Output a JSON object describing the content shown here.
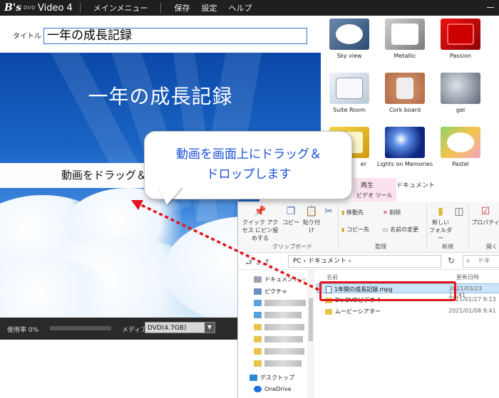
{
  "app": {
    "logo_b": "B's",
    "logo_dvd": "DVD",
    "logo_name": "Video 4",
    "menu": [
      "メインメニュー",
      "保存",
      "設定",
      "ヘルプ"
    ],
    "window_minimize": "ー"
  },
  "title_field": {
    "label": "タイトル",
    "value": "一年の成長記録"
  },
  "preview": {
    "menu_title": "一年の成長記録",
    "drag_hint": "動画をドラッグ＆"
  },
  "status": {
    "usage": "使用率 0%",
    "usage_fraction": 0,
    "media_label": "メディア",
    "media_value": "DVD(4.7GB)"
  },
  "templates": [
    {
      "label": "Sky view",
      "color": "#3a5f8f",
      "icon": "oval-frame"
    },
    {
      "label": "Metallic",
      "color": "#9a9a9a",
      "icon": "rounded-frame"
    },
    {
      "label": "Passion",
      "color": "#c30f0f",
      "icon": "rounded-frame"
    },
    {
      "label": "Suite Room",
      "color": "#dfe8f2",
      "icon": "stacked-frames"
    },
    {
      "label": "Cork board",
      "color": "#c98560",
      "icon": "photo-on-cork"
    },
    {
      "label": "gel",
      "color": "#6c7787",
      "icon": "water-drop"
    },
    {
      "label": "er",
      "color": "#e8c220",
      "icon": "yellow-frame"
    },
    {
      "label": "Lights on Memories",
      "color": "#0d2a8a",
      "icon": "light-glow"
    },
    {
      "label": "Pastel",
      "color": "#f3c14a",
      "icon": "oval-frame"
    }
  ],
  "callout": {
    "line1": "動画を画面上にドラッグ＆",
    "line2": "ドロップします"
  },
  "explorer": {
    "ribbon_tabs": {
      "play": "再生",
      "video_tools": "ビデオ ツール",
      "document": "ドキュメント"
    },
    "ribbon_buttons": {
      "pin": "クイック アクセス にピン留めする",
      "copy": "コピー",
      "paste": "貼り付け",
      "move_to": "移動先",
      "copy_to": "コピー先",
      "delete": "削除",
      "rename": "名前の変更",
      "new_folder": "新しい フォルダー",
      "properties": "プロパティ"
    },
    "ribbon_groups": {
      "clipboard": "クリップボード",
      "organize": "整理",
      "new": "新規",
      "open": "開く"
    },
    "address": "PC › ドキュメント ›",
    "search_placeholder": "ドキ",
    "nav": {
      "documents": "ドキュメント",
      "pictures": "ピクチャ",
      "desktop": "デスクトップ",
      "onedrive": "OneDrive"
    },
    "columns": {
      "name": "名前",
      "modified": "更新日時"
    },
    "files": [
      {
        "name": "1年間の成長記録.mpg",
        "date": "2021/03/23 17:41"
      },
      {
        "name": "B's DVDビデオ 4",
        "date": "2021/01/27 9:13"
      },
      {
        "name": "ムービーシアター",
        "date": "2021/01/08 9:41"
      }
    ]
  }
}
